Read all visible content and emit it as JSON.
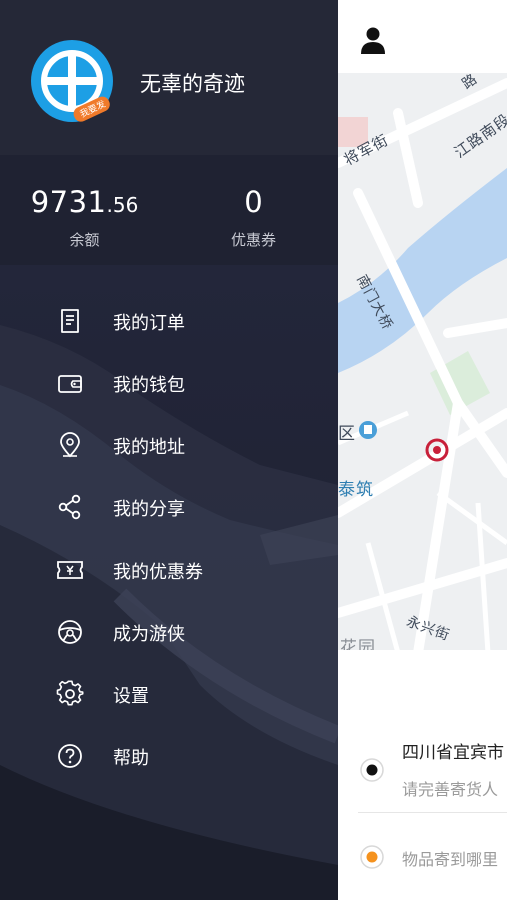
{
  "user": {
    "name": "无辜的奇迹",
    "avatar_badge": "我要发"
  },
  "stats": {
    "balance_int": "9731",
    "balance_dec": ".56",
    "balance_label": "余额",
    "coupons_value": "0",
    "coupons_label": "优惠券"
  },
  "menu": [
    {
      "label": "我的订单",
      "icon": "order-document-icon"
    },
    {
      "label": "我的钱包",
      "icon": "wallet-icon"
    },
    {
      "label": "我的地址",
      "icon": "location-pin-icon"
    },
    {
      "label": "我的分享",
      "icon": "share-icon"
    },
    {
      "label": "我的优惠券",
      "icon": "coupon-ticket-icon"
    },
    {
      "label": "成为游侠",
      "icon": "steering-wheel-icon"
    },
    {
      "label": "设置",
      "icon": "gear-icon"
    },
    {
      "label": "帮助",
      "icon": "help-circle-icon"
    }
  ],
  "map": {
    "labels": {
      "street1": "将军街",
      "street2": "江路南段",
      "bridge": "南门大桥",
      "district": "区",
      "building": "泰筑",
      "street3": "永兴街",
      "garden": "花园",
      "corner": "路"
    }
  },
  "order": {
    "from": "四川省宜宾市",
    "from_hint": "请完善寄货人",
    "to_hint": "物品寄到哪里"
  },
  "colors": {
    "drawer_bg": "#1f2232",
    "drawer_header": "#252837",
    "avatar_blue": "#1d9fe5",
    "badge_orange": "#f07a2a",
    "river": "#b8d4f2",
    "origin_dot": "#111111",
    "destination_dot": "#f5921e",
    "metro_red": "#c8203a"
  }
}
